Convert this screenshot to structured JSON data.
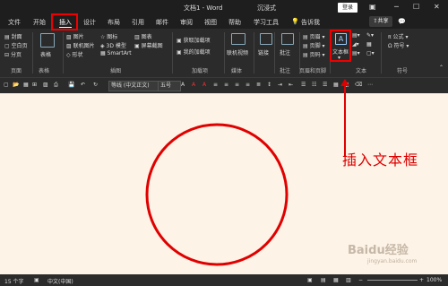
{
  "titlebar": {
    "doc_title": "文档1 - Word",
    "center_label": "沉浸式",
    "login": "登录"
  },
  "menu": [
    "文件",
    "开始",
    "插入",
    "设计",
    "布局",
    "引用",
    "邮件",
    "审阅",
    "视图",
    "帮助",
    "学习工具"
  ],
  "search_placeholder": "告诉我",
  "share_label": "共享",
  "ribbon": {
    "pages": [
      "封面",
      "空白页",
      "分页"
    ],
    "table": "表格",
    "illustrations": [
      "图片",
      "联机图片",
      "形状",
      "图标",
      "3D 模型",
      "SmartArt",
      "图表",
      "屏幕截图"
    ],
    "addins": [
      "获取加载项",
      "我的加载项"
    ],
    "media": "联机视频",
    "links": "链接",
    "comment": "批注",
    "header_footer": [
      "页眉",
      "页脚",
      "页码"
    ],
    "textbox": "文本框",
    "formula": "公式",
    "symbol": "符号",
    "groups": [
      "页面",
      "表格",
      "插图",
      "加载项",
      "媒体",
      "批注",
      "页眉和页脚",
      "文本",
      "符号"
    ]
  },
  "format": {
    "font": "等线 (中文正文)",
    "size": "五号"
  },
  "status": {
    "words": "15 个字",
    "lang": "中文(中国)",
    "zoom": "100%"
  },
  "annotation": "插入文本框",
  "colors": {
    "accent_red": "#e00000",
    "doc_bg": "#fdf3e6",
    "ribbon_bg": "#2b2b2b"
  },
  "watermark": "Baidu经验",
  "watermark_sub": "jingyan.baidu.com"
}
